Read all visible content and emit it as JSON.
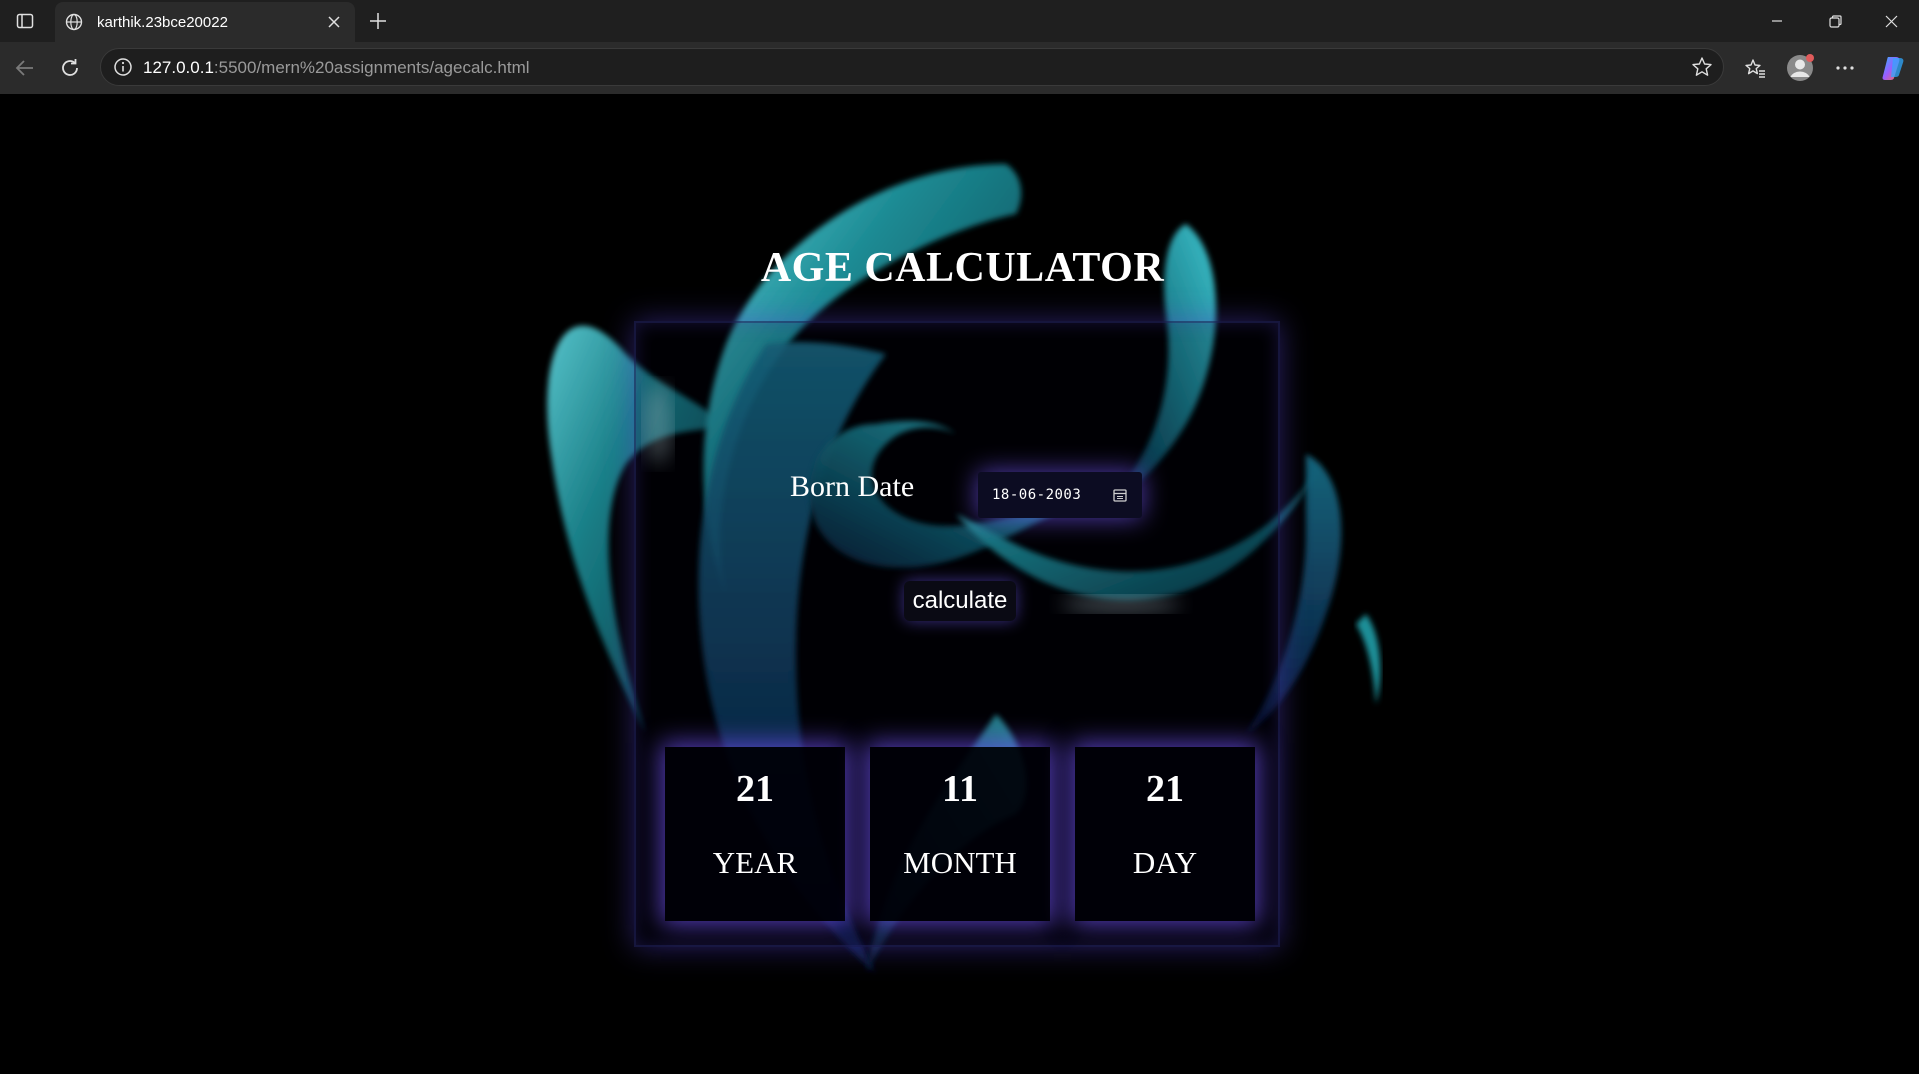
{
  "browser": {
    "tab_title": "karthik.23bce20022",
    "url_host": "127.0.0.1",
    "url_path": ":5500/mern%20assignments/agecalc.html"
  },
  "page": {
    "title": "AGE CALCULATOR",
    "born_label": "Born Date",
    "date_value": "18-06-2003",
    "calculate_label": "calculate",
    "results": [
      {
        "value": "21",
        "label": "YEAR"
      },
      {
        "value": "11",
        "label": "MONTH"
      },
      {
        "value": "21",
        "label": "DAY"
      }
    ]
  },
  "colors": {
    "glow": "#6a50f0",
    "art_teal": "#1c8a93",
    "background": "#000000"
  }
}
